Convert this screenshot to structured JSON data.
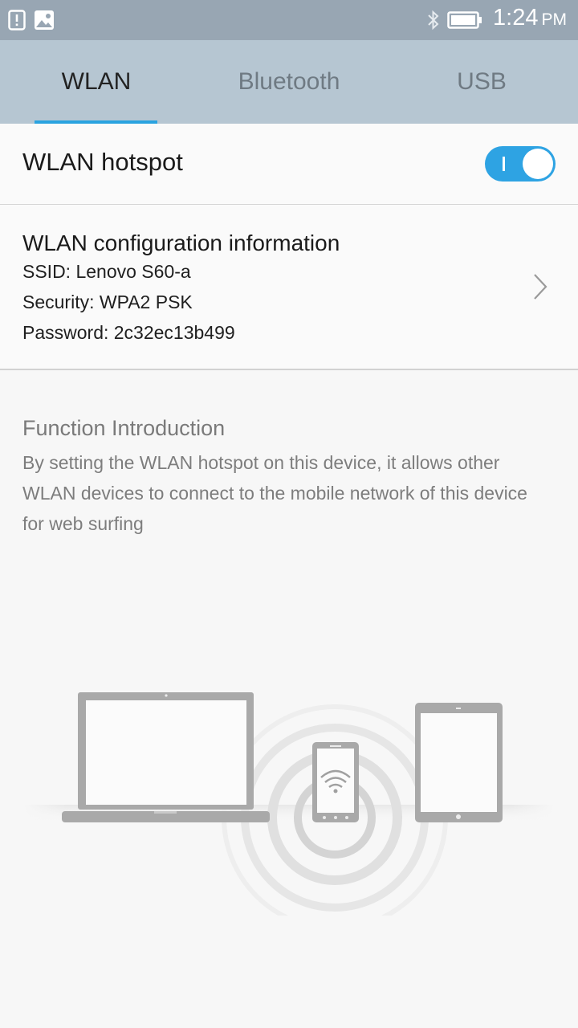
{
  "status_bar": {
    "time": "1:24",
    "ampm": "PM",
    "icons": [
      "alert-notification-icon",
      "image-notification-icon",
      "bluetooth-icon",
      "battery-icon"
    ],
    "background": "#98a6b3"
  },
  "tabs": [
    {
      "label": "WLAN",
      "active": true
    },
    {
      "label": "Bluetooth",
      "active": false
    },
    {
      "label": "USB",
      "active": false
    }
  ],
  "accent_color": "#2aa3e0",
  "hotspot": {
    "label": "WLAN hotspot",
    "enabled": true
  },
  "config": {
    "title": "WLAN configuration information",
    "ssid": "SSID: Lenovo S60-a",
    "security": "Security: WPA2 PSK",
    "password": "Password: 2c32ec13b499"
  },
  "intro": {
    "title": "Function Introduction",
    "body": "By setting the WLAN hotspot on this device, it allows other WLAN devices to connect to the mobile network of this device for web surfing"
  }
}
